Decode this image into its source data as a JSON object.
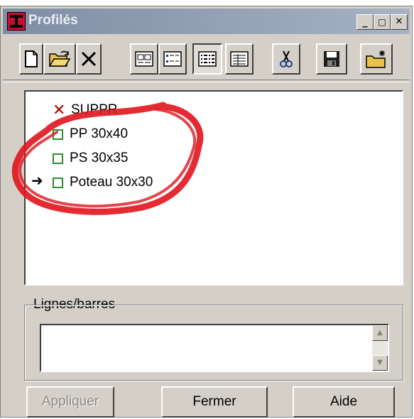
{
  "window": {
    "title": "Profilés",
    "controls": {
      "minimize": "_",
      "maximize": "□",
      "close": "✕"
    }
  },
  "toolbar": {
    "items": [
      {
        "name": "new",
        "icon": "new-document-icon"
      },
      {
        "name": "open",
        "icon": "open-folder-icon"
      },
      {
        "name": "delete",
        "icon": "delete-x-icon"
      },
      {
        "name": "view-large",
        "icon": "view-large-icons-icon"
      },
      {
        "name": "view-small",
        "icon": "view-small-icons-icon"
      },
      {
        "name": "view-list",
        "icon": "view-list-icon",
        "pressed": true
      },
      {
        "name": "view-details",
        "icon": "view-details-icon"
      },
      {
        "name": "cut",
        "icon": "scissors-icon"
      },
      {
        "name": "save",
        "icon": "floppy-disk-icon"
      },
      {
        "name": "new-folder",
        "icon": "new-folder-icon"
      }
    ]
  },
  "list": {
    "items": [
      {
        "label": "SUPPR",
        "type": "delete"
      },
      {
        "label": "PP 30x40",
        "type": "checkbox"
      },
      {
        "label": "PS 30x35",
        "type": "checkbox"
      },
      {
        "label": "Poteau 30x30",
        "type": "checkbox",
        "pointed": true
      }
    ],
    "pointer": "➜"
  },
  "group": {
    "legend": "Lignes/barres",
    "scroll_up": "▲",
    "scroll_down": "▼"
  },
  "buttons": {
    "apply": "Appliquer",
    "close": "Fermer",
    "help": "Aide"
  },
  "colors": {
    "annotation": "#e0141e",
    "checkbox": "#2f8f2f",
    "delete_mark": "#b00000"
  }
}
